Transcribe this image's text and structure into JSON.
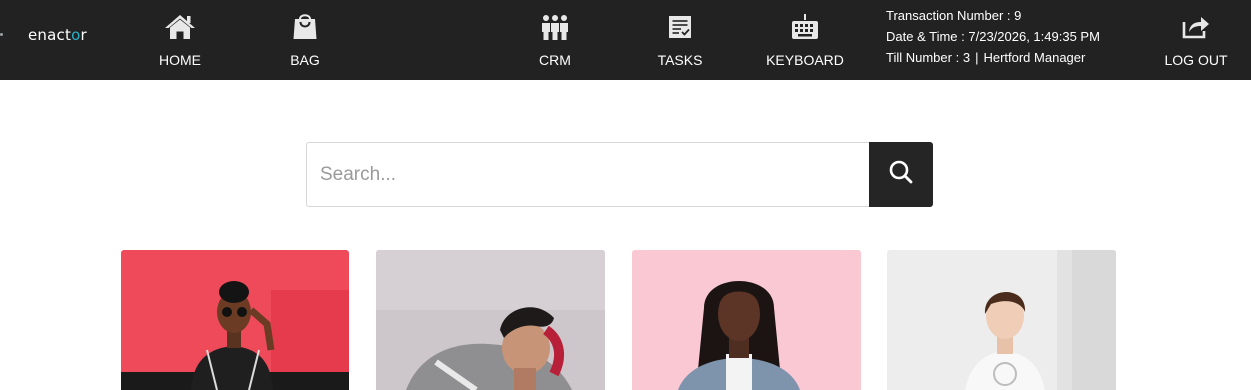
{
  "brand": {
    "logo_text_start": "enact",
    "logo_text_o": "o",
    "logo_text_end": "r"
  },
  "nav": {
    "home": {
      "label": "HOME",
      "icon": "home-icon"
    },
    "bag": {
      "label": "BAG",
      "icon": "bag-icon"
    },
    "crm": {
      "label": "CRM",
      "icon": "people-icon"
    },
    "tasks": {
      "label": "TASKS",
      "icon": "tasks-icon"
    },
    "keyboard": {
      "label": "KEYBOARD",
      "icon": "keyboard-icon"
    },
    "logout": {
      "label": "LOG OUT",
      "icon": "share-export-icon"
    }
  },
  "session": {
    "transaction_label": "Transaction Number :",
    "transaction_number": "9",
    "datetime_label": "Date & Time :",
    "datetime_value": "7/23/2026, 1:49:35 PM",
    "till_label": "Till Number :",
    "till_number": "3",
    "separator": "|",
    "user": "Hertford Manager"
  },
  "search": {
    "placeholder": "Search...",
    "value": "",
    "button_icon": "search-icon"
  },
  "colors": {
    "topbar": "#222222",
    "accent": "#2ab0c8",
    "search_button": "#252525"
  },
  "products": [
    {
      "image": "person-in-red-room-photo"
    },
    {
      "image": "person-on-grey-background-photo"
    },
    {
      "image": "girl-on-pink-background-photo"
    },
    {
      "image": "child-on-white-background-photo"
    }
  ]
}
